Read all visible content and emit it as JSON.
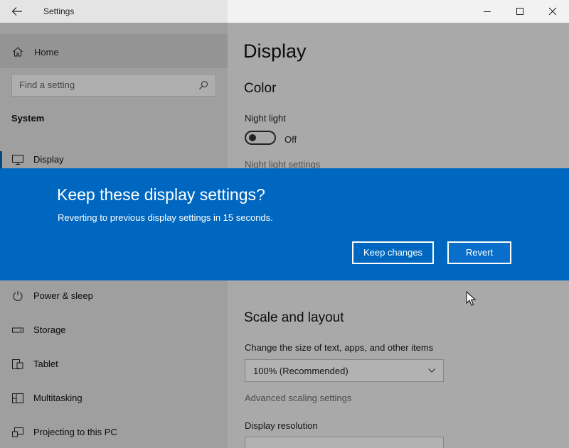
{
  "window": {
    "title": "Settings",
    "icons": {
      "back": "back-arrow-icon",
      "minimize": "minimize-icon",
      "maximize": "maximize-icon",
      "close": "close-icon"
    }
  },
  "sidebar": {
    "home_label": "Home",
    "search_placeholder": "Find a setting",
    "section": "System",
    "items": [
      {
        "label": "Display",
        "icon": "monitor-icon",
        "active": true
      },
      {
        "label": "Power & sleep",
        "icon": "power-icon",
        "active": false
      },
      {
        "label": "Storage",
        "icon": "storage-icon",
        "active": false
      },
      {
        "label": "Tablet",
        "icon": "tablet-icon",
        "active": false
      },
      {
        "label": "Multitasking",
        "icon": "multitasking-icon",
        "active": false
      },
      {
        "label": "Projecting to this PC",
        "icon": "projecting-icon",
        "active": false
      }
    ]
  },
  "main": {
    "title": "Display",
    "color_section": "Color",
    "night_light_label": "Night light",
    "night_light_state": "Off",
    "night_light_settings_link": "Night light settings",
    "scale_section": "Scale and layout",
    "scale_label": "Change the size of text, apps, and other items",
    "scale_value": "100% (Recommended)",
    "advanced_scaling_link": "Advanced scaling settings",
    "resolution_label": "Display resolution"
  },
  "dialog": {
    "title": "Keep these display settings?",
    "message": "Reverting to previous display settings in 15 seconds.",
    "keep_label": "Keep changes",
    "revert_label": "Revert"
  },
  "colors": {
    "accent": "#0067c0",
    "sidebar_bg": "#e4e4e4",
    "main_bg": "#f2f2f2"
  }
}
